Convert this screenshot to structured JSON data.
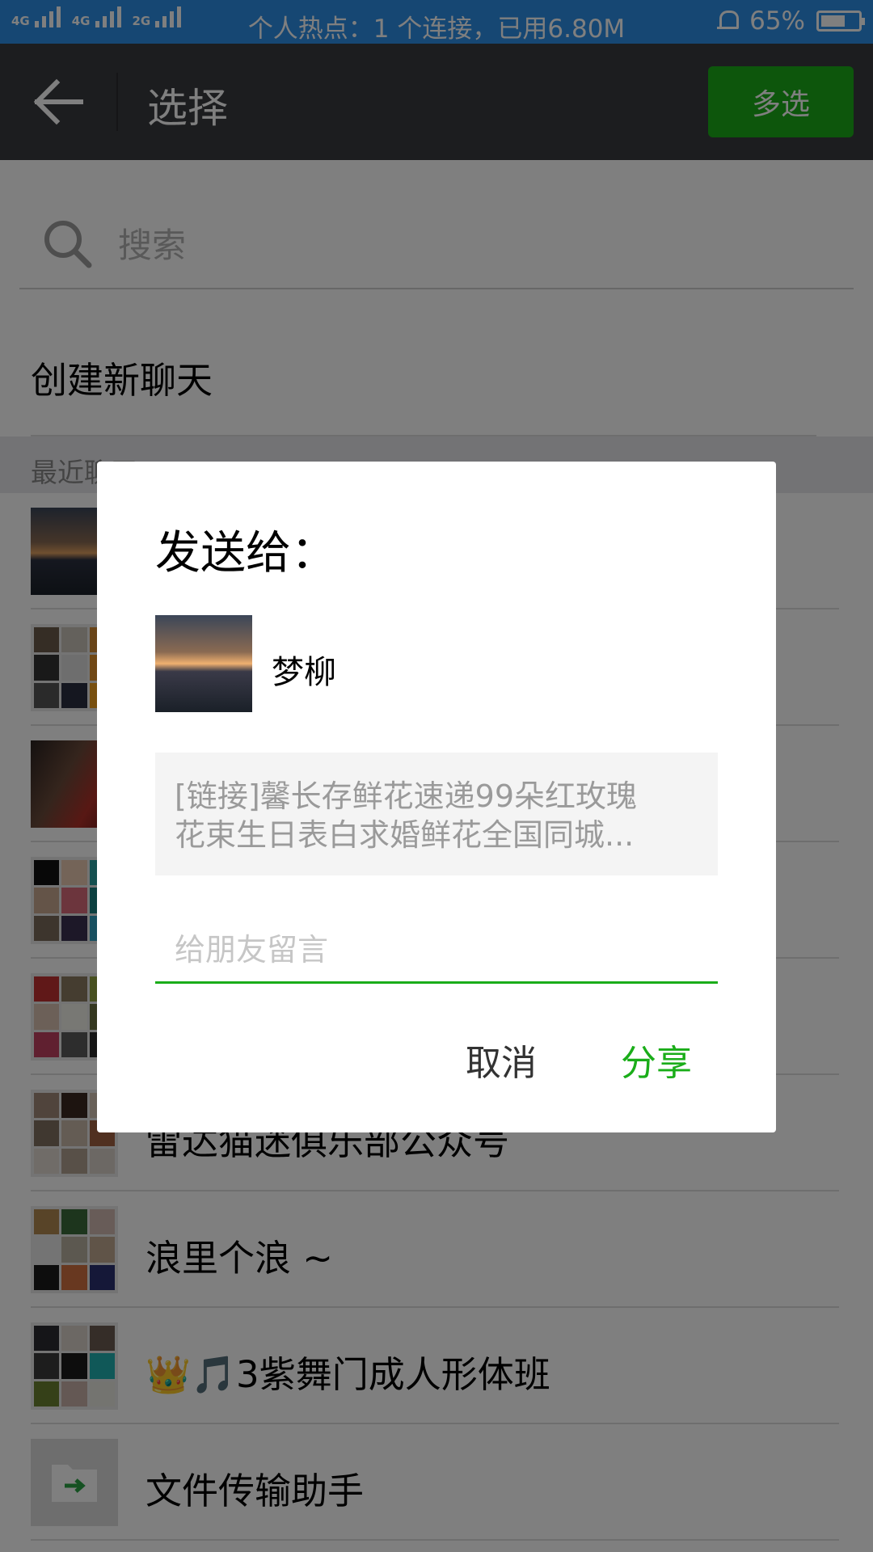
{
  "status_bar": {
    "signal_tags": [
      "4G",
      "4G",
      "2G"
    ],
    "hotspot_text": "个人热点：1 个连接，已用6.80M",
    "battery_text": "65%",
    "battery_level": 0.65
  },
  "header": {
    "title": "选择",
    "multi_select_label": "多选"
  },
  "search": {
    "placeholder": "搜索"
  },
  "new_chat_label": "创建新聊天",
  "recent_section_label": "最近聊天",
  "list": {
    "rows": [
      {
        "name": "",
        "avatar": "photo-sunset"
      },
      {
        "name": "",
        "avatar": "group-grid"
      },
      {
        "name": "",
        "avatar": "photo-portrait"
      },
      {
        "name": "",
        "avatar": "group-grid"
      },
      {
        "name": "",
        "avatar": "group-grid"
      },
      {
        "name": "雷达猫迷俱乐部公众号",
        "avatar": "group-grid"
      },
      {
        "name": "浪里个浪 ~",
        "avatar": "group-grid"
      },
      {
        "name": "👑🎵3紫舞门成人形体班",
        "avatar": "group-grid"
      },
      {
        "name": "文件传输助手",
        "avatar": "file-transfer-icon"
      }
    ]
  },
  "dialog": {
    "title": "发送给：",
    "recipient_name": "梦柳",
    "preview_line1": "[链接]馨长存鲜花速递99朵红玫瑰",
    "preview_line2": "花束生日表白求婚鲜花全国同城...",
    "message_placeholder": "给朋友留言",
    "cancel_label": "取消",
    "share_label": "分享"
  },
  "colors": {
    "status_bar": "#2d8fe6",
    "title_bar": "#393a3f",
    "accent_green": "#1aad19"
  }
}
